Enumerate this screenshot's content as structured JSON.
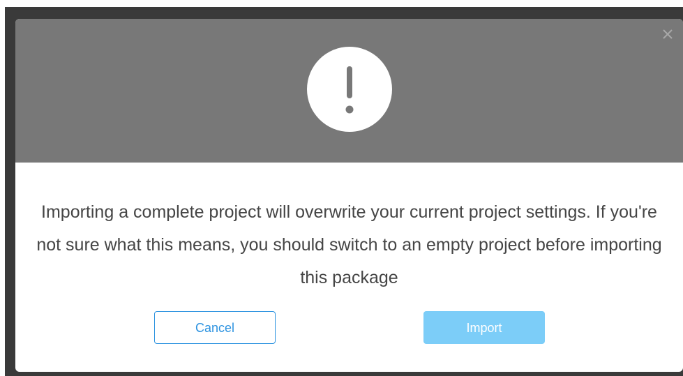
{
  "dialog": {
    "message": "Importing a complete project will overwrite your current project settings. If you're not sure what this means, you should switch to an empty project before importing this package",
    "cancel_label": "Cancel",
    "import_label": "Import"
  },
  "icons": {
    "close": "close-icon",
    "warning": "exclamation-icon"
  },
  "colors": {
    "header_bg": "#787878",
    "primary": "#2d93e0",
    "import_bg": "#7ccdf8",
    "text": "#454545"
  }
}
